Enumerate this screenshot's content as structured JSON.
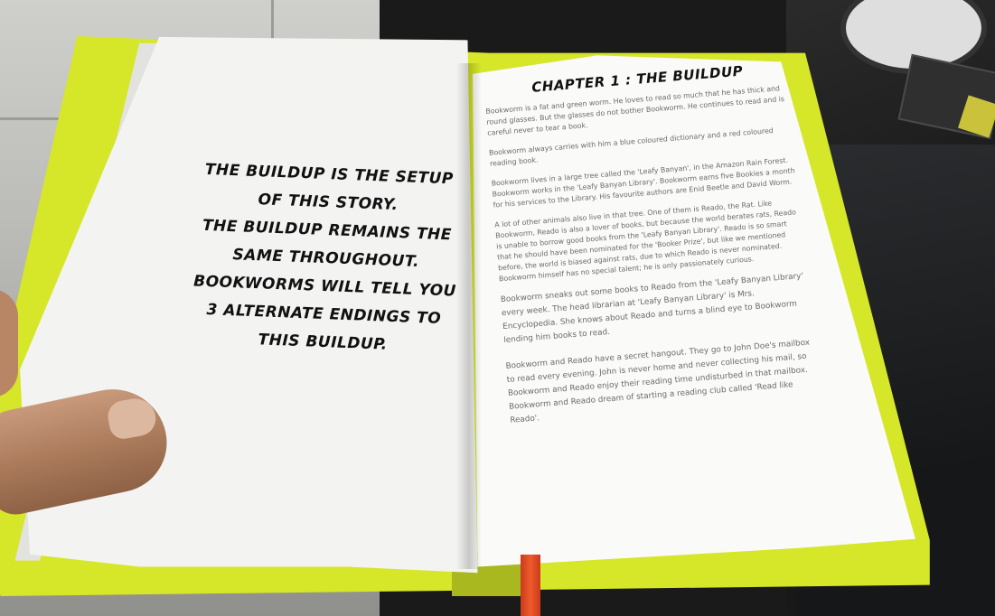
{
  "left_page": {
    "lines": [
      "THE BUILDUP IS THE SETUP",
      "OF THIS STORY.",
      "THE BUILDUP REMAINS THE",
      "SAME THROUGHOUT.",
      "BOOKWORMS WILL TELL YOU",
      "3 ALTERNATE ENDINGS TO",
      "THIS BUILDUP."
    ]
  },
  "right_page": {
    "chapter_title": "CHAPTER 1 : THE BUILDUP",
    "paragraphs": [
      "Bookworm is a fat and green worm. He loves to read so much that he has thick and round glasses. But the glasses do not bother Bookworm. He continues to read and is careful never to tear a book.",
      "Bookworm always carries with him a blue coloured dictionary and a red coloured reading book.",
      "Bookworm lives in a large tree called the 'Leafy Banyan', in the Amazon Rain Forest. Bookworm works in the 'Leafy Banyan Library'. Bookworm earns five Bookies a month for his services to the Library. His favourite authors are Enid Beetle and David Worm.",
      "A lot of other animals also live in that tree. One of them is Reado, the Rat. Like Bookworm, Reado is also a lover of books, but because the world berates rats, Reado is unable to borrow good books from the 'Leafy Banyan Library'. Reado is so smart that he should have been nominated for the 'Booker Prize', but like we mentioned before, the world is biased against rats, due to which Reado is never nominated. Bookworm himself has no special talent; he is only passionately curious.",
      "Bookworm sneaks out some books to Reado from the 'Leafy Banyan Library' every week. The head librarian at 'Leafy Banyan Library' is Mrs. Encyclopedia. She knows about Reado and turns a blind eye to Bookworm lending him books to read.",
      "Bookworm and Reado have a secret hangout. They go to John Doe's mailbox to read every evening. John is never home and never collecting his mail, so Bookworm and Reado enjoy their reading time undisturbed in that mailbox. Bookworm and Reado dream of starting a reading club called 'Read like Reado'."
    ]
  },
  "colors": {
    "cover": "#d6e628",
    "page": "#fafaf8",
    "ribbon": "#ef5a2c",
    "body_text": "#6a6a6a",
    "headline_text": "#111111"
  }
}
